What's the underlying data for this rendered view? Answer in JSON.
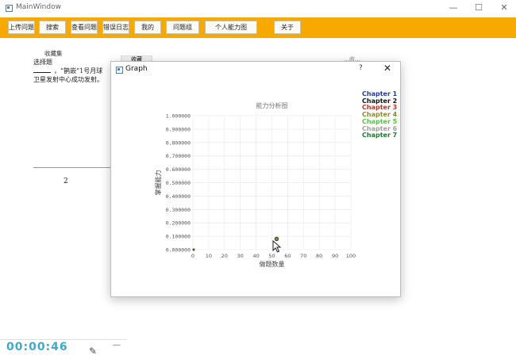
{
  "window": {
    "title": "MainWindow",
    "minimize": "—",
    "maximize": "☐",
    "close": "✕"
  },
  "toolbar": {
    "buttons": [
      {
        "label": "上传问题",
        "name": "upload-question-button"
      },
      {
        "label": "搜索",
        "name": "search-button"
      },
      {
        "label": "查看问题",
        "name": "view-questions-button"
      },
      {
        "label": "错误日志",
        "name": "error-log-button"
      },
      {
        "label": "我的",
        "name": "my-button"
      },
      {
        "label": "问题组",
        "name": "question-group-button"
      },
      {
        "label": "个人能力图",
        "name": "ability-chart-button"
      },
      {
        "label": "关于",
        "name": "about-button"
      }
    ]
  },
  "background": {
    "collect_label": "收藏集",
    "question_type": "选择题",
    "question_line1": "，“鹊嵌”1号月球",
    "question_line2": "卫星发射中心成功发射。",
    "collect_tag": "收藏",
    "ghost_right": "…收…",
    "page_number": "2"
  },
  "clock": {
    "time": "00:00:46",
    "pen": "✎",
    "minimize": "—"
  },
  "dialog": {
    "title": "Graph",
    "help": "?",
    "close": "✕"
  },
  "chart_data": {
    "type": "scatter",
    "title": "能力分析图",
    "xlabel": "做题数量",
    "ylabel": "掌握能力",
    "xlim": [
      0,
      100
    ],
    "ylim": [
      0,
      1
    ],
    "x_ticks": [
      "0",
      "10",
      "20",
      "30",
      "40",
      "50",
      "60",
      "70",
      "80",
      "90",
      "100"
    ],
    "y_ticks": [
      "0.000000",
      "0.100000",
      "0.200000",
      "0.300000",
      "0.400000",
      "0.500000",
      "0.600000",
      "0.700000",
      "0.800000",
      "0.900000",
      "1.000000"
    ],
    "grid": true,
    "legend_position": "top-right",
    "series": [
      {
        "name": "Chapter 1",
        "color": "#1f3a9e",
        "points": []
      },
      {
        "name": "Chapter 2",
        "color": "#111111",
        "points": []
      },
      {
        "name": "Chapter 3",
        "color": "#c0321f",
        "points": []
      },
      {
        "name": "Chapter 4",
        "color": "#8a8a2a",
        "points": [
          [
            53,
            0.08
          ]
        ]
      },
      {
        "name": "Chapter 5",
        "color": "#4ccc3a",
        "points": []
      },
      {
        "name": "Chapter 6",
        "color": "#a0a0a0",
        "points": []
      },
      {
        "name": "Chapter 7",
        "color": "#1d7a2a",
        "points": [
          [
            0,
            0.0
          ]
        ]
      }
    ]
  }
}
